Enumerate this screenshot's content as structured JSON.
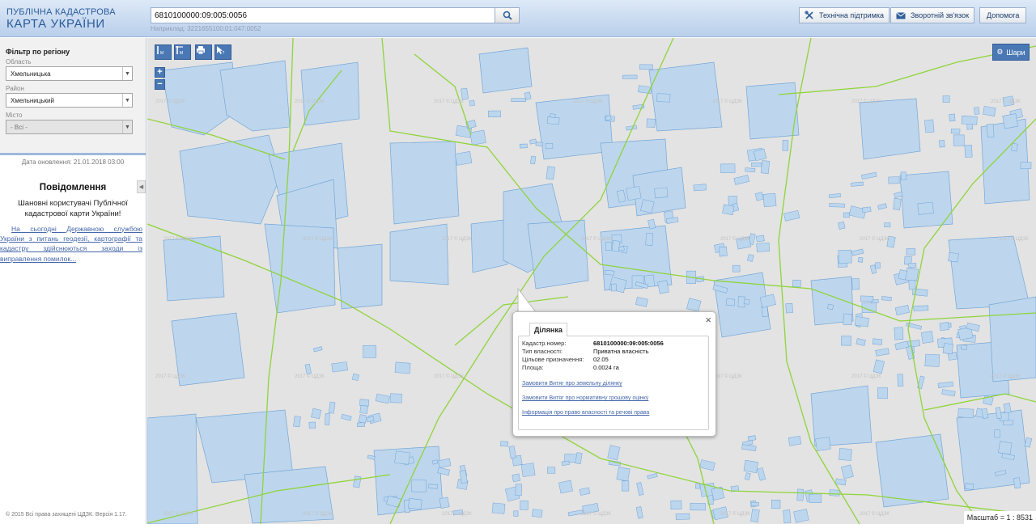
{
  "header": {
    "logo_line1": "ПУБЛІЧНА КАДАСТРОВА",
    "logo_line2": "КАРТА УКРАЇНИ",
    "search_value": "6810100000:09:005:0056",
    "search_hint": "Наприклад: 3221655100:01:047:0052",
    "buttons": [
      {
        "label": "Технічна підтримка",
        "icon": "tools-icon"
      },
      {
        "label": "Зворотній зв'язок",
        "icon": "envelope-icon"
      },
      {
        "label": "Допомога",
        "icon": ""
      }
    ]
  },
  "sidebar": {
    "filter_title": "Фільтр по регіону",
    "oblast_label": "Область",
    "oblast_value": "Хмельницька",
    "rayon_label": "Район",
    "rayon_value": "Хмельницький",
    "city_label": "Місто",
    "city_value": "- Всі -",
    "updated": "Дата оновлення: 21.01.2018 03:00",
    "notice_title": "Повідомлення",
    "notice_text": "Шановні користувачі Публічної кадастрової карти України!",
    "notice_link": "На сьогодні Державною службою України з питань геодезії, картографії та кадастру здійснюються заходи із виправлення помилок...",
    "copyright": "© 2015 Всі права захищені ЦДЗК. Версія 1.17."
  },
  "map": {
    "layers_label": "Шари",
    "scale_label": "Масштаб = 1 : 8531",
    "tools": [
      "measure-length-icon",
      "measure-area-icon",
      "print-icon",
      "info-pointer-icon"
    ],
    "watermark": "2017 © ЦДЗК"
  },
  "popup": {
    "tab_label": "Ділянка",
    "fields": [
      {
        "key": "Кадастр.номер:",
        "value": "6810100000:09:005:0056",
        "bold": true
      },
      {
        "key": "Тип власності:",
        "value": "Приватна власність",
        "bold": false
      },
      {
        "key": "Цільове призначення:",
        "value": "02.05",
        "bold": false
      },
      {
        "key": "Площа:",
        "value": "0.0024 га",
        "bold": false
      }
    ],
    "links": [
      "Замовити Витяг про земельну ділянку",
      "Замовити Витяг про нормативну грошову оцінку",
      "Інформація про право власності та речові права"
    ]
  },
  "colors": {
    "parcel_fill": "#bcd6ee",
    "parcel_stroke": "#6fa3d6",
    "boundary": "#8fd43a",
    "map_bg": "#e3e3e3",
    "tool_blue": "#4a78b4"
  }
}
